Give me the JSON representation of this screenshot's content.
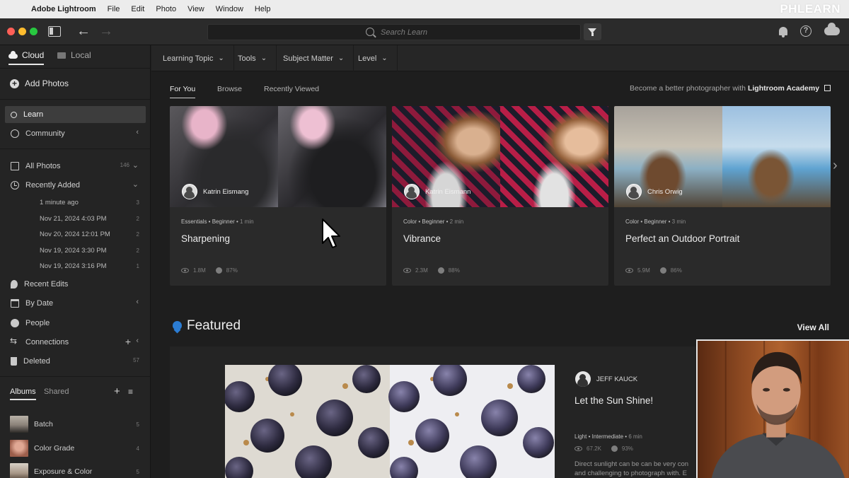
{
  "menubar": {
    "app_name": "Adobe Lightroom",
    "items": [
      "File",
      "Edit",
      "Photo",
      "View",
      "Window",
      "Help"
    ],
    "watermark": "PHLEARN"
  },
  "titlebar": {
    "search_placeholder": "Search Learn"
  },
  "sidebar": {
    "source_tabs": {
      "cloud": "Cloud",
      "local": "Local"
    },
    "add_photos": "Add Photos",
    "learn": "Learn",
    "community": "Community",
    "all_photos": {
      "label": "All Photos",
      "count": "146"
    },
    "recently_added": {
      "label": "Recently Added"
    },
    "recent_groups": [
      {
        "label": "1 minute ago",
        "count": "3"
      },
      {
        "label": "Nov 21, 2024 4:03 PM",
        "count": "2"
      },
      {
        "label": "Nov 20, 2024 12:01 PM",
        "count": "2"
      },
      {
        "label": "Nov 19, 2024 3:30 PM",
        "count": "2"
      },
      {
        "label": "Nov 19, 2024 3:16 PM",
        "count": "1"
      }
    ],
    "recent_edits": "Recent Edits",
    "by_date": "By Date",
    "people": "People",
    "connections": "Connections",
    "deleted": {
      "label": "Deleted",
      "count": "57"
    },
    "album_tabs": {
      "albums": "Albums",
      "shared": "Shared"
    },
    "albums": [
      {
        "label": "Batch",
        "count": "5"
      },
      {
        "label": "Color Grade",
        "count": "4"
      },
      {
        "label": "Exposure & Color",
        "count": "5"
      }
    ]
  },
  "filterbar": {
    "dropdowns": [
      "Learning Topic",
      "Tools",
      "Subject Matter",
      "Level"
    ]
  },
  "learn_tabs": {
    "for_you": "For You",
    "browse": "Browse",
    "recently_viewed": "Recently Viewed"
  },
  "academy": {
    "prefix": "Become a better photographer with",
    "link": "Lightroom Academy"
  },
  "cards": [
    {
      "author": "Katrin Eismang",
      "meta": "Essentials • Beginner • ",
      "duration": "1 min",
      "title": "Sharpening",
      "views": "1.8M",
      "rating": "87%"
    },
    {
      "author": "Katrin Eismann",
      "meta": "Color • Beginner • ",
      "duration": "2 min",
      "title": "Vibrance",
      "views": "2.3M",
      "rating": "88%"
    },
    {
      "author": "Chris Orwig",
      "meta": "Color • Beginner • ",
      "duration": "3 min",
      "title": "Perfect an Outdoor Portrait",
      "views": "5.9M",
      "rating": "86%"
    }
  ],
  "featured": {
    "heading": "Featured",
    "view_all": "View All",
    "author": "JEFF KAUCK",
    "title": "Let the Sun Shine!",
    "meta": "Light • Intermediate • ",
    "duration": "6 min",
    "views": "67.2K",
    "rating": "93%",
    "description_line1": "Direct sunlight can be can be very con",
    "description_line2": "and challenging to photograph with. E"
  },
  "colors": {
    "accent_blue": "#2b7cd3",
    "background": "#1e1e1e",
    "sidebar": "#242424",
    "card": "#2a2a2a"
  }
}
